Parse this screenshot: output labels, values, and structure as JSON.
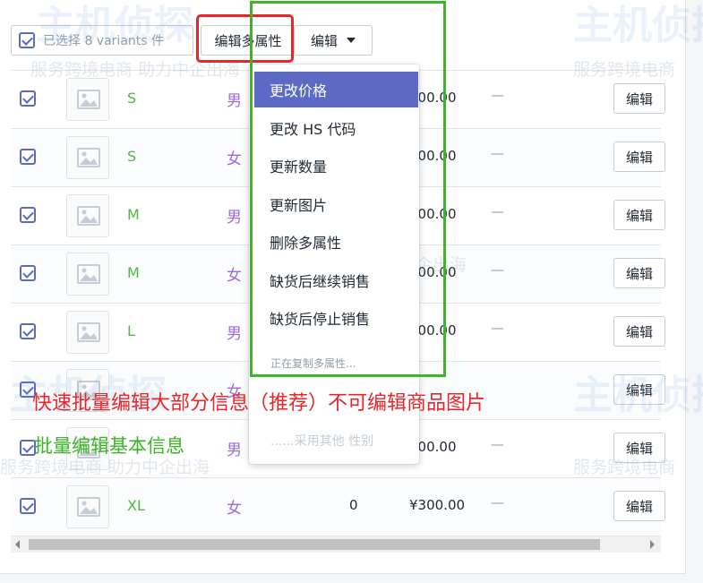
{
  "bulk": {
    "selected_label": "已选择 8 variants 件",
    "edit_options_label": "编辑多属性",
    "edit_label": "编辑"
  },
  "variants": [
    {
      "size": "S",
      "gender": "男",
      "qty": "",
      "price": "300.00",
      "edit": "编辑"
    },
    {
      "size": "S",
      "gender": "女",
      "qty": "",
      "price": "300.00",
      "edit": "编辑"
    },
    {
      "size": "M",
      "gender": "男",
      "qty": "",
      "price": "300.00",
      "edit": "编辑"
    },
    {
      "size": "M",
      "gender": "女",
      "qty": "",
      "price": "300.00",
      "edit": "编辑"
    },
    {
      "size": "L",
      "gender": "男",
      "qty": "",
      "price": "300.00",
      "edit": "编辑"
    },
    {
      "size": "",
      "gender": "女",
      "qty": "",
      "price": "",
      "edit": "编辑"
    },
    {
      "size": "",
      "gender": "男",
      "qty": "",
      "price": "300.00",
      "edit": "编辑"
    },
    {
      "size": "XL",
      "gender": "女",
      "qty": "0",
      "price": "¥300.00",
      "edit": "编辑"
    }
  ],
  "dash": "—",
  "dropdown": {
    "items": [
      "更改价格",
      "更改 HS 代码",
      "更新数量",
      "更新图片",
      "删除多属性",
      "缺货后继续销售",
      "缺货后停止销售"
    ],
    "status": "正在复制多属性...",
    "status2": "......采用其他 性别"
  },
  "annotations": {
    "red": "快速批量编辑大部分信息（推荐）不可编辑商品图片",
    "green": "批量编辑基本信息"
  },
  "watermark": {
    "brand": "主机侦探",
    "slogan": "服务跨境电商  助力中企出海",
    "slogan_short": "服务跨境电商"
  },
  "colors": {
    "accent": "#5c6ac4",
    "size_green": "#50b83c",
    "gender_purple": "#9c6ade",
    "annotation_red": "#e8262a",
    "annotation_green": "#3cb526"
  }
}
